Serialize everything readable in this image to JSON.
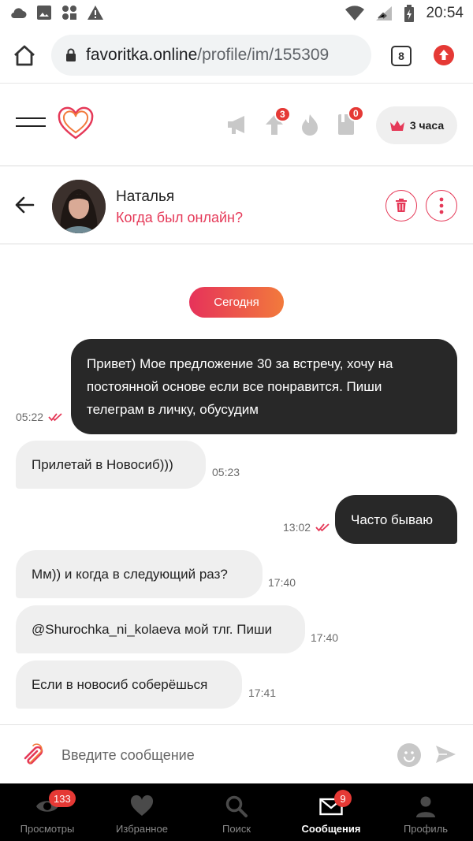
{
  "status_bar": {
    "time": "20:54"
  },
  "browser": {
    "domain": "favoritka.online",
    "path": "/profile/im/155309",
    "tab_count": "8"
  },
  "header": {
    "boost_badge": "3",
    "notifications_badge": "0",
    "premium_label": "3 часа",
    "accent_color": "#e53958"
  },
  "chat": {
    "contact_name": "Наталья",
    "contact_status": "Когда был онлайн?",
    "date_separator": "Сегодня",
    "messages": [
      {
        "dir": "out",
        "text": "Привет) Мое предложение 30 за встречу, хочу на постоянной основе если все понравится. Пиши телеграм в личку, обусудим",
        "time": "05:22",
        "read": true
      },
      {
        "dir": "in",
        "text": "Прилетай в Новосиб)))",
        "time": "05:23"
      },
      {
        "dir": "out",
        "text": "Часто бываю",
        "time": "13:02",
        "read": true
      },
      {
        "dir": "in",
        "text": "Мм)) и когда в следующий раз?",
        "time": "17:40"
      },
      {
        "dir": "in",
        "text": "@Shurochka_ni_kolaeva мой тлг. Пиши",
        "time": "17:40"
      },
      {
        "dir": "in",
        "text": "Если в новосиб соберёшься",
        "time": "17:41"
      }
    ]
  },
  "composer": {
    "placeholder": "Введите сообщение"
  },
  "bottom_nav": [
    {
      "label": "Просмотры",
      "icon": "eye-icon",
      "badge": "133"
    },
    {
      "label": "Избранное",
      "icon": "heart-icon"
    },
    {
      "label": "Поиск",
      "icon": "search-icon"
    },
    {
      "label": "Сообщения",
      "icon": "envelope-icon",
      "badge": "9",
      "active": true
    },
    {
      "label": "Профиль",
      "icon": "person-icon"
    }
  ]
}
